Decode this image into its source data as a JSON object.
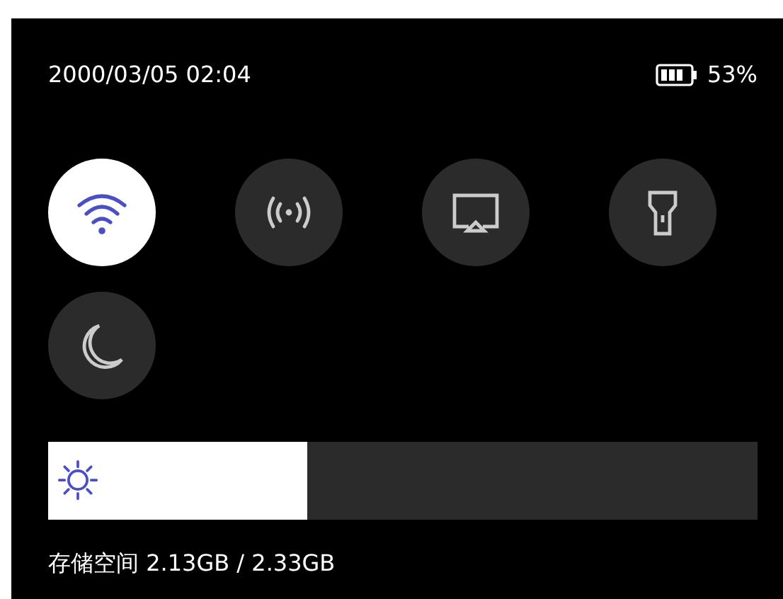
{
  "status_bar": {
    "datetime": "2000/03/05 02:04",
    "battery": "53%"
  },
  "toggles": [
    {
      "kind": "wifi",
      "on": true
    },
    {
      "kind": "hotspot",
      "on": false
    },
    {
      "kind": "cast",
      "on": false
    },
    {
      "kind": "flashlight",
      "on": false
    },
    {
      "kind": "night",
      "on": false
    }
  ],
  "brightness": {
    "level": 0.365
  },
  "storage": "存储空间 2.13GB / 2.33GB"
}
